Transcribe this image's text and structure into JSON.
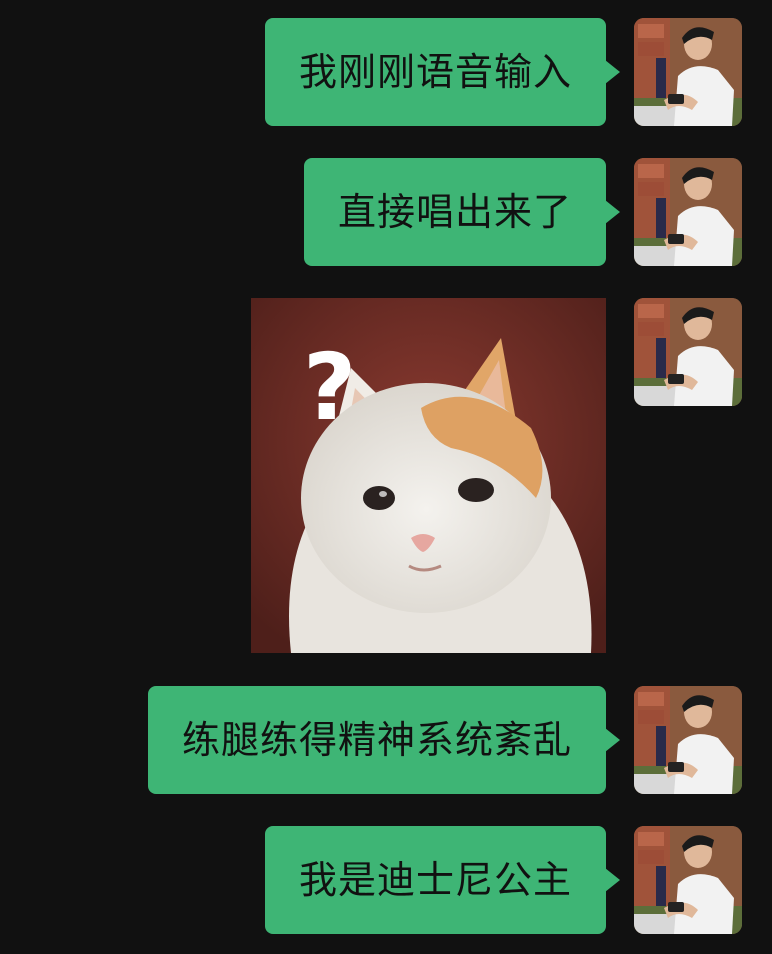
{
  "messages": [
    {
      "type": "text",
      "text": "我刚刚语音输入"
    },
    {
      "type": "text",
      "text": "直接唱出来了"
    },
    {
      "type": "image",
      "icon": "cat-sticker-question",
      "text": "?"
    },
    {
      "type": "text",
      "text": "练腿练得精神系统紊乱"
    },
    {
      "type": "text",
      "text": "我是迪士尼公主"
    }
  ],
  "colors": {
    "background": "#111111",
    "bubble": "#3eb575",
    "bubble_text": "#111111"
  }
}
